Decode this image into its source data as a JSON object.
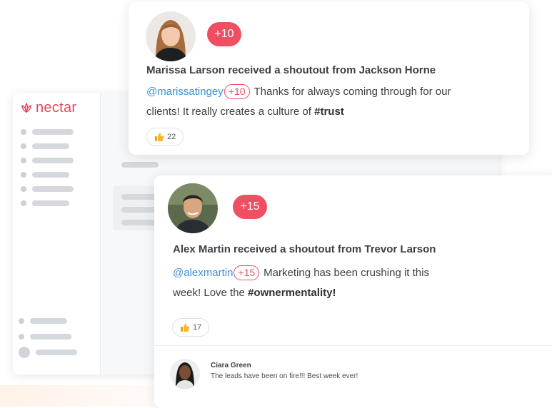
{
  "app": {
    "logo_text": "nectar",
    "brand_color": "#e1475a",
    "accent_color": "#ef4f62",
    "mention_color": "#3c8fd6"
  },
  "shoutouts": [
    {
      "avatar_icon": "person-avatar",
      "points_badge": "+10",
      "title": "Marissa Larson received a shoutout from Jackson Horne",
      "mention": "@marissatingey",
      "inline_points": "+10",
      "message_before_tag": "Thanks for always coming through for our clients! It really creates a culture of ",
      "hashtag": "#trust",
      "message_after_tag": "",
      "reaction_icon": "thumbs-up-icon",
      "reaction_count": "22"
    },
    {
      "avatar_icon": "person-avatar",
      "points_badge": "+15",
      "title": "Alex Martin received a shoutout from Trevor Larson",
      "mention": "@alexmartin",
      "inline_points": "+15",
      "message_before_tag": "Marketing has been crushing it this week! Love the ",
      "hashtag": "#ownermentality",
      "message_after_tag": "!",
      "reaction_icon": "thumbs-up-icon",
      "reaction_count": "17",
      "comment": {
        "author": "Ciara Green",
        "text": "The leads have been on fire!!! Best week ever!"
      }
    }
  ]
}
